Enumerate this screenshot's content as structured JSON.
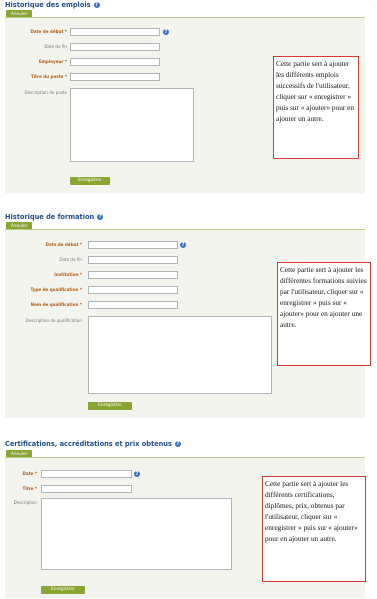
{
  "corner_mark": ".",
  "employment": {
    "title": "Historique des emplois",
    "cancel_label": "Annuler",
    "fields": {
      "start_date": "Date de début *",
      "end_date": "Date de fin",
      "employer": "Employeur *",
      "job_title": "Titre du poste *",
      "job_description": "Description du poste"
    },
    "save_label": "Enregistrer",
    "note": "Cette partie sert à ajouter les différents emplois successifs de l'utilisateur, cliquer sur « enregistrer » puis sur « ajouter» pour en ajouter un autre."
  },
  "education": {
    "title": "Historique de formation",
    "cancel_label": "Annuler",
    "fields": {
      "start_date": "Date de début *",
      "end_date": "Date de fin",
      "institution": "Institution *",
      "qualification_type": "Type de qualification *",
      "qualification_name": "Nom de qualification *",
      "qualification_description": "Description de qualification"
    },
    "save_label": "Enregistrer",
    "note": "Cette partie sert à ajouter les différentes formations suivies par l'utilisateur, cliquer sur « enregistrer » puis sur « ajouter» pour en ajouter une autre."
  },
  "certifications": {
    "title": "Certifications, accréditations et prix obtenus",
    "cancel_label": "Annuler",
    "fields": {
      "date": "Date *",
      "title": "Titre *",
      "description": "Description"
    },
    "save_label": "Enregistrer",
    "note": "Cette partie sert à ajouter les différents certifications, diplômes, prix, obtenus par l'utilisateur, cliquer sur « enregistrer » puis sur « ajouter» pour en ajouter un autre."
  },
  "icons": {
    "help": "help-icon"
  },
  "colors": {
    "accent_green": "#8aa534",
    "title_blue": "#1f4e8c",
    "note_border": "#d83a32",
    "required_label": "#b35a14"
  }
}
